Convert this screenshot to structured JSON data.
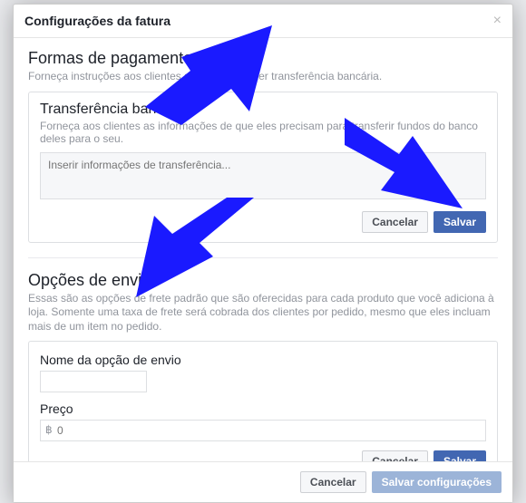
{
  "modal": {
    "title": "Configurações da fatura"
  },
  "payment": {
    "title": "Formas de pagamento",
    "desc": "Forneça instruções aos clientes sobre como fazer transferência bancária.",
    "panel_title": "Transferência bancária",
    "panel_desc": "Forneça aos clientes as informações de que eles precisam para transferir fundos do banco deles para o seu.",
    "textarea_placeholder": "Inserir informações de transferência...",
    "cancel": "Cancelar",
    "save": "Salvar"
  },
  "shipping": {
    "title": "Opções de envio",
    "desc": "Essas são as opções de frete padrão que são oferecidas para cada produto que você adiciona à loja. Somente uma taxa de frete será cobrada dos clientes por pedido, mesmo que eles incluam mais de um item no pedido.",
    "name_label": "Nome da opção de envio",
    "price_label": "Preço",
    "price_symbol": "฿",
    "price_placeholder": "0",
    "cancel": "Cancelar",
    "save": "Salvar"
  },
  "footer": {
    "cancel": "Cancelar",
    "save": "Salvar configurações"
  }
}
